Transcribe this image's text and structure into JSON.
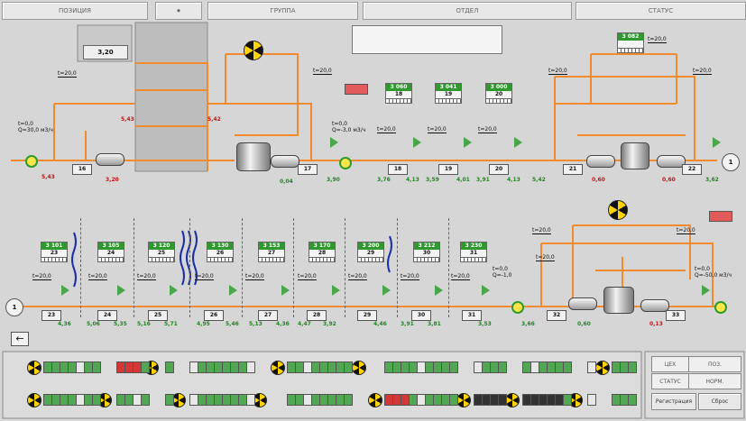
{
  "top_bar": {
    "field1": "ПОЗИЦИЯ",
    "field2": "⏺",
    "field3": "ГРУППА",
    "field4": "ОТДЕЛ",
    "field5": "СТАТУС"
  },
  "upper": {
    "box_value": "3,20",
    "header_box_line1": "",
    "temps": {
      "t1": "t=0,0",
      "q1": "Q=30,0 м3/ч",
      "t2": "t=20,0",
      "t3": "t=20,0",
      "t4": "t=0,0",
      "q4": "Q=-3,0 м3/ч",
      "t5": "t=20,0",
      "t6": "t=20,0",
      "t7": "t=20,0",
      "t8": "t=20,0",
      "t9": "t=20,0",
      "t10": "t=20,0"
    },
    "gauges": [
      {
        "value": "3 060",
        "num": "18"
      },
      {
        "value": "3 041",
        "num": "19"
      },
      {
        "value": "3 000",
        "num": "20"
      },
      {
        "value": "3 082",
        "num": ""
      }
    ],
    "nodes": [
      "16",
      "17",
      "18",
      "19",
      "20",
      "21",
      "22"
    ],
    "red_values": [
      "5,43",
      "5,43",
      "5,42",
      "3,20",
      "0,60",
      "0,60"
    ],
    "green_values": [
      "0,04",
      "3,90",
      "3,76",
      "4,13",
      "3,59",
      "4,01",
      "3,91",
      "4,13",
      "5,42",
      "3,62"
    ],
    "circle_label": "1"
  },
  "lower": {
    "temps": [
      "t=20,0",
      "t=20,0",
      "t=20,0",
      "t=20,0",
      "t=20,0",
      "t=20,0",
      "t=20,0",
      "t=20,0",
      "t=20,0",
      "t=20,0",
      "t=20,0",
      "t=20,0"
    ],
    "flow_left": "t=0,0\nQ=-1,0",
    "flow_right": "t=0,0\nQ=-50,0 м3/ч",
    "gauges": [
      {
        "value": "3 101",
        "num": "23"
      },
      {
        "value": "3 105",
        "num": "24"
      },
      {
        "value": "3 120",
        "num": "25"
      },
      {
        "value": "3 130",
        "num": "26"
      },
      {
        "value": "3 153",
        "num": "27"
      },
      {
        "value": "3 170",
        "num": "28"
      },
      {
        "value": "3 200",
        "num": "29"
      },
      {
        "value": "3 212",
        "num": "30"
      },
      {
        "value": "3 230",
        "num": "31"
      }
    ],
    "nodes": [
      "23",
      "24",
      "25",
      "26",
      "27",
      "28",
      "29",
      "30",
      "31",
      "32",
      "33"
    ],
    "green_values": [
      "4,36",
      "5,06",
      "5,35",
      "5,16",
      "5,71",
      "4,95",
      "5,46",
      "5,13",
      "4,36",
      "4,47",
      "3,92",
      "4,46",
      "3,91",
      "3,81",
      "3,53",
      "3,66",
      "0,60"
    ],
    "red_values": [
      "0,13"
    ],
    "circle_label": "1"
  },
  "back_button": "←",
  "right_panel": {
    "row1_label": "ЦЕХ",
    "row1_value": "ПОЗ.",
    "row2_label": "СТАТУС",
    "row2_value": "НОРМ.",
    "btn_register": "Регистрация",
    "btn_reset": "Сброс"
  },
  "colors": {
    "pipe": "#f28a2e",
    "green": "#2f9a3a",
    "yellow": "#ffe24a",
    "red": "#d01010"
  }
}
